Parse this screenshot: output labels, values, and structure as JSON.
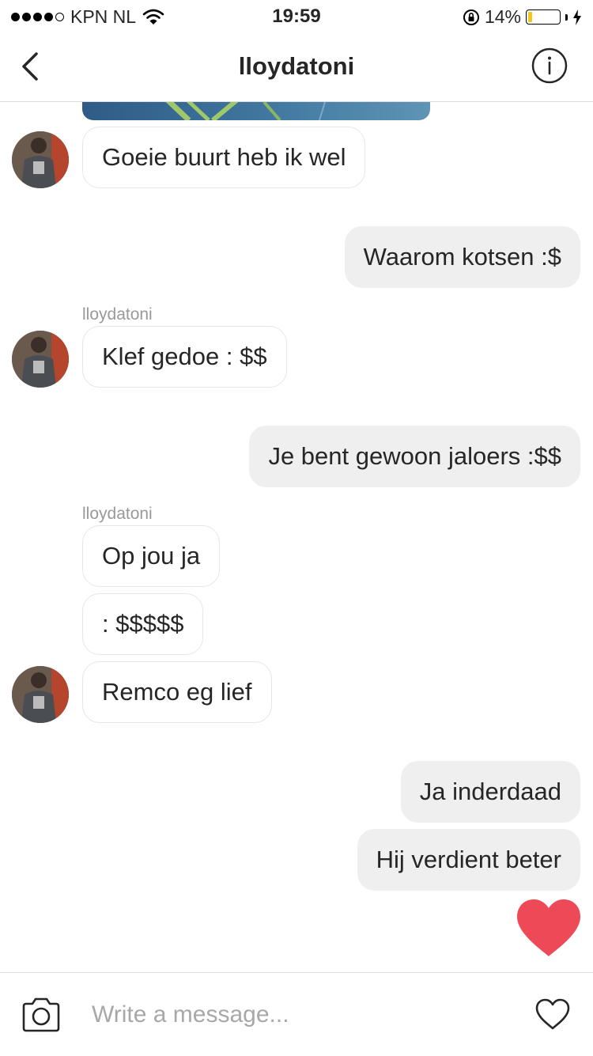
{
  "status_bar": {
    "carrier": "KPN NL",
    "time": "19:59",
    "battery_percent": "14%",
    "battery_level": 0.14,
    "signal_bars_filled": 4,
    "signal_bars_total": 5
  },
  "header": {
    "title": "lloydatoni",
    "back_icon": "chevron-left-icon",
    "info_icon": "info-icon"
  },
  "messages": [
    {
      "from": "them",
      "text": "Goeie buurt heb ik wel",
      "avatar": true
    },
    {
      "from": "me",
      "text": "Waarom kotsen :$"
    },
    {
      "from": "them",
      "sender": "lloydatoni",
      "text": "Klef gedoe : $$",
      "avatar": true
    },
    {
      "from": "me",
      "text": "Je bent gewoon jaloers :$$"
    },
    {
      "from": "them",
      "sender": "lloydatoni",
      "text": "Op jou ja"
    },
    {
      "from": "them",
      "text": ": $$$$$"
    },
    {
      "from": "them",
      "text": "Remco eg lief",
      "avatar": true
    },
    {
      "from": "me",
      "text": "Ja inderdaad"
    },
    {
      "from": "me",
      "text": "Hij verdient beter"
    },
    {
      "from": "me",
      "type": "heart",
      "icon": "heart-icon"
    }
  ],
  "composer": {
    "placeholder": "Write a message...",
    "value": "",
    "camera_icon": "camera-icon",
    "like_icon": "heart-outline-icon"
  },
  "colors": {
    "heart": "#ed4956",
    "outgoing_bubble": "#efefef",
    "incoming_border": "#e6e6e6",
    "battery_fill": "#f5c518"
  }
}
